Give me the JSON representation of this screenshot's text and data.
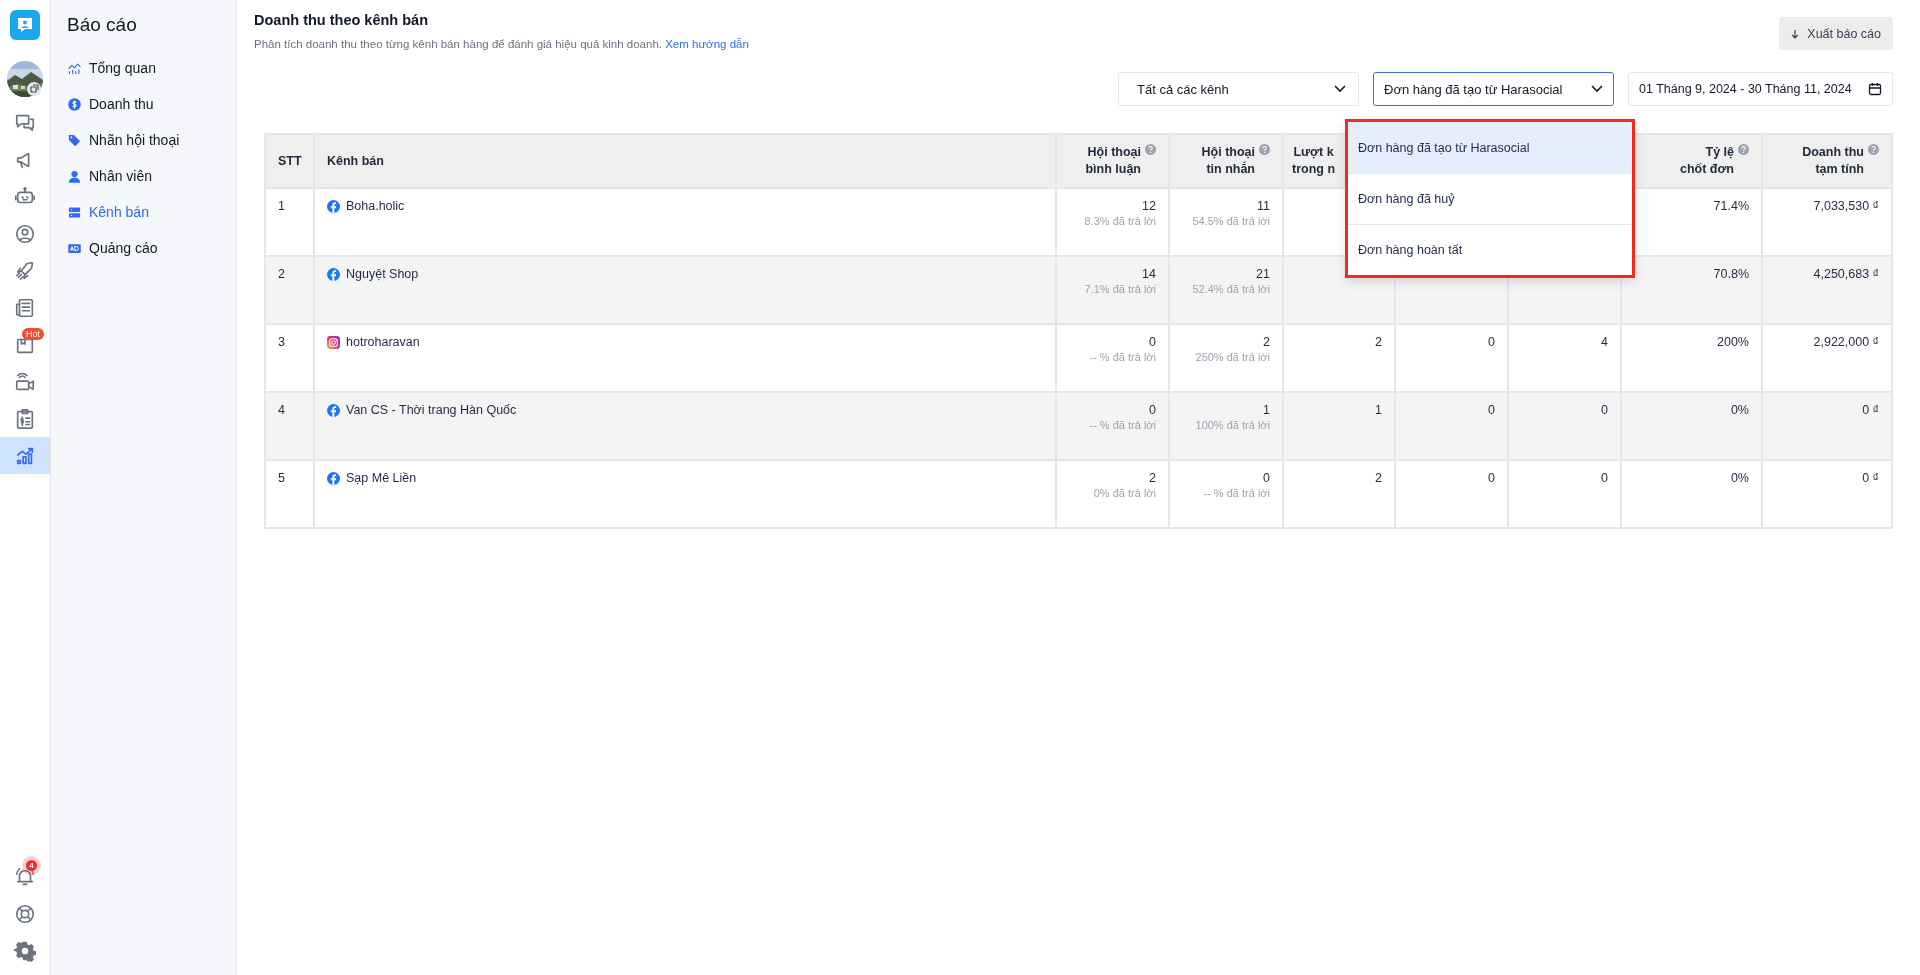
{
  "rail": {
    "items": [
      {
        "kind": "avatar",
        "selected": false
      },
      {
        "kind": "chat",
        "selected": false
      },
      {
        "kind": "megaphone",
        "selected": false
      },
      {
        "kind": "robot",
        "selected": false
      },
      {
        "kind": "user",
        "selected": false
      },
      {
        "kind": "rocket",
        "selected": false
      },
      {
        "kind": "news",
        "selected": false
      },
      {
        "kind": "box",
        "selected": false,
        "badge": "Hot"
      },
      {
        "kind": "video",
        "selected": false
      },
      {
        "kind": "clipboard",
        "selected": false
      },
      {
        "kind": "chart",
        "selected": true
      }
    ],
    "bottom": [
      {
        "kind": "bell",
        "badge": "4"
      },
      {
        "kind": "help"
      },
      {
        "kind": "settings"
      }
    ]
  },
  "sidebar": {
    "title": "Báo cáo",
    "items": [
      {
        "label": "Tổng quan",
        "kind": "overview",
        "selected": false
      },
      {
        "label": "Doanh thu",
        "kind": "revenue",
        "selected": false
      },
      {
        "label": "Nhãn hội thoại",
        "kind": "tag",
        "selected": false
      },
      {
        "label": "Nhân viên",
        "kind": "staff",
        "selected": false
      },
      {
        "label": "Kênh bán",
        "kind": "channel",
        "selected": true
      },
      {
        "label": "Quảng cáo",
        "kind": "ads",
        "selected": false
      }
    ]
  },
  "header": {
    "title": "Doanh thu theo kênh bán",
    "description": "Phân tích doanh thu theo từng kênh bán hàng để đánh giá hiệu quả kinh doanh.",
    "link": "Xem hướng dẫn",
    "export_button": "Xuất báo cáo"
  },
  "filters": {
    "channel": {
      "value": "Tất cả các kênh",
      "open": false
    },
    "order_type": {
      "value": "Đơn hàng đã tạo từ Harasocial",
      "open": true,
      "options": [
        {
          "label": "Đơn hàng đã tạo từ Harasocial",
          "selected": true
        },
        {
          "label": "Đơn hàng đã huỷ",
          "selected": false
        },
        {
          "label": "Đơn hàng hoàn tất",
          "selected": false
        }
      ]
    },
    "date_range": "01 Tháng 9, 2024 - 30 Tháng 11, 2024"
  },
  "table": {
    "columns": [
      {
        "lines": [
          "STT"
        ],
        "help": false
      },
      {
        "lines": [
          "Kênh bán"
        ],
        "help": false
      },
      {
        "lines": [
          "Hội thoại",
          "bình luận"
        ],
        "help": true
      },
      {
        "lines": [
          "Hội thoại",
          "tin nhắn"
        ],
        "help": true
      },
      {
        "lines": [
          "Lượt k",
          "trong n"
        ],
        "help": false
      },
      "",
      "",
      {
        "lines": [
          "Tỷ lệ",
          "chốt đơn"
        ],
        "help": true
      },
      {
        "lines": [
          "Doanh thu",
          "tạm tính"
        ],
        "help": true
      }
    ],
    "rows": [
      {
        "cells": [
          {
            "value": "1"
          },
          {
            "value": "Boha.holic",
            "kind": "facebook"
          },
          {
            "value": "12",
            "note": "8.3% đã trả lời"
          },
          {
            "value": "11",
            "note": "54.5% đã trả lời"
          },
          "",
          "",
          "",
          {
            "value": "71.4%"
          },
          {
            "value": "7,033,530 ₫"
          }
        ]
      },
      {
        "cells": [
          {
            "value": "2"
          },
          {
            "value": "Nguyệt Shop",
            "kind": "facebook"
          },
          {
            "value": "14",
            "note": "7.1% đã trả lời"
          },
          {
            "value": "21",
            "note": "52.4% đã trả lời"
          },
          "",
          "",
          "",
          {
            "value": "70.8%"
          },
          {
            "value": "4,250,683 ₫"
          }
        ]
      },
      {
        "cells": [
          {
            "value": "3"
          },
          {
            "value": "hotroharavan",
            "kind": "instagram"
          },
          {
            "value": "0",
            "note": "-- % đã trả lời"
          },
          {
            "value": "2",
            "note": "250% đã trả lời"
          },
          {
            "value": "2"
          },
          {
            "value": "0"
          },
          {
            "value": "4"
          },
          {
            "value": "200%"
          },
          {
            "value": "2,922,000 ₫"
          }
        ]
      },
      {
        "cells": [
          {
            "value": "4"
          },
          {
            "value": "Van CS - Thời trang Hàn Quốc",
            "kind": "facebook"
          },
          {
            "value": "0",
            "note": "-- % đã trả lời"
          },
          {
            "value": "1",
            "note": "100% đã trả lời"
          },
          {
            "value": "1"
          },
          {
            "value": "0"
          },
          {
            "value": "0"
          },
          {
            "value": "0%"
          },
          {
            "value": "0 ₫"
          }
        ]
      },
      {
        "cells": [
          {
            "value": "5"
          },
          {
            "value": "Sạp Mê Liền",
            "kind": "facebook"
          },
          {
            "value": "2",
            "note": "0% đã trả lời"
          },
          {
            "value": "0",
            "note": "-- % đã trả lời"
          },
          {
            "value": "2"
          },
          {
            "value": "0"
          },
          {
            "value": "0"
          },
          {
            "value": "0%"
          },
          {
            "value": "0 ₫"
          }
        ]
      }
    ]
  }
}
